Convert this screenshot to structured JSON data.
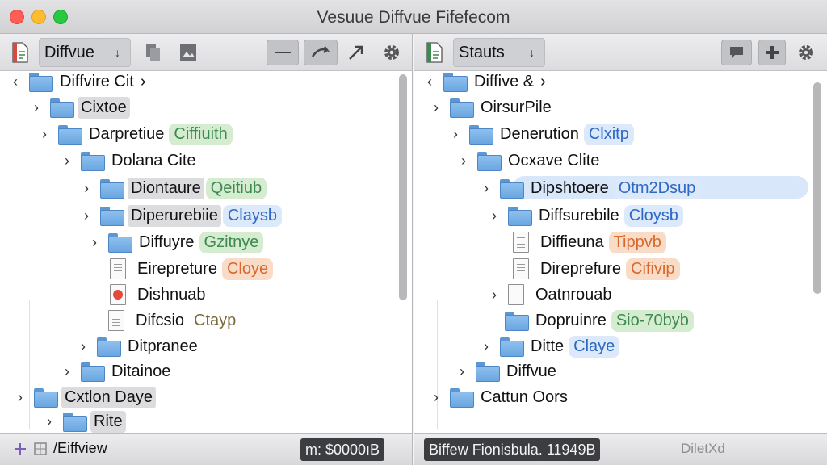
{
  "window": {
    "title": "Vesuue Diffvue Fifefecom"
  },
  "left_pane": {
    "toolbar": {
      "dropdown_label": "Diffvue",
      "caret": "↓"
    },
    "tree": [
      {
        "label": "Diffvire Cit",
        "suffix": "›",
        "tag": "",
        "tag_color": ""
      },
      {
        "label": "Cixtoe",
        "tag": "",
        "tag_color": ""
      },
      {
        "label": "Darpretiue",
        "tag": "Ciffiuith",
        "tag_color": "green"
      },
      {
        "label": "Dolana Cite",
        "tag": "",
        "tag_color": ""
      },
      {
        "label": "Diontaure",
        "tag": "Qeitiub",
        "tag_color": "green"
      },
      {
        "label": "Diperurebiie",
        "tag": "Claysb",
        "tag_color": "blue"
      },
      {
        "label": "Diffuyre",
        "tag": "Gzitnye",
        "tag_color": "green"
      },
      {
        "label": "Eirepreture",
        "tag": "Cloye",
        "tag_color": "orange"
      },
      {
        "label": "Dishnuab",
        "tag": "",
        "tag_color": ""
      },
      {
        "label": "Difcsio",
        "tag": "Ctayp",
        "tag_color": "plain"
      },
      {
        "label": "Ditpranee",
        "tag": "",
        "tag_color": ""
      },
      {
        "label": "Ditainoe",
        "tag": "",
        "tag_color": ""
      },
      {
        "label": "Cxtlon Daye",
        "tag": "",
        "tag_color": ""
      },
      {
        "label": "Rite",
        "tag": "",
        "tag_color": ""
      }
    ],
    "status": {
      "left_text": "/Eiffview",
      "right_text": "m: $0000ıB"
    }
  },
  "right_pane": {
    "toolbar": {
      "dropdown_label": "Stauts",
      "caret": "↓"
    },
    "tree": [
      {
        "label": "Diffive &",
        "suffix": "›",
        "tag": "",
        "tag_color": ""
      },
      {
        "label": "OirsurPile",
        "tag": "",
        "tag_color": ""
      },
      {
        "label": "Denerution",
        "tag": "Clxitp",
        "tag_color": "blue"
      },
      {
        "label": "Ocxave Clite",
        "tag": "",
        "tag_color": ""
      },
      {
        "label": "Dipshtoere",
        "tag": "Otm2Dsup",
        "tag_color": "blue"
      },
      {
        "label": "Diffsurebile",
        "tag": "Cloysb",
        "tag_color": "blue"
      },
      {
        "label": "Diffieuna",
        "tag": "Tippvb",
        "tag_color": "orange"
      },
      {
        "label": "Direprefure",
        "tag": "Cifivip",
        "tag_color": "orange"
      },
      {
        "label": "Oatnrouab",
        "tag": "",
        "tag_color": ""
      },
      {
        "label": "Dopruinre",
        "tag": "Sio-70byb",
        "tag_color": "green"
      },
      {
        "label": "Ditte",
        "tag": "Claye",
        "tag_color": "blue"
      },
      {
        "label": "Diffvue",
        "tag": "",
        "tag_color": ""
      },
      {
        "label": "Cattun Oors",
        "tag": "",
        "tag_color": ""
      }
    ],
    "status": {
      "left_text": "Biffew Fionisbula. 11949B",
      "right_text": "DiletXd"
    }
  },
  "colors": {
    "selection": "#d9e7fb",
    "tag_green": "#3c8a4f",
    "tag_blue": "#2d68c4",
    "tag_orange": "#d9682d",
    "folder": "#6aa6e0"
  },
  "icons": [
    "document-icon",
    "copy-icon",
    "image-icon",
    "minus-icon",
    "share-icon",
    "arrow-icon",
    "gear-icon",
    "comment-icon",
    "plus-icon",
    "folder-icon",
    "file-icon",
    "chevron-right-icon",
    "chevron-down-icon"
  ]
}
